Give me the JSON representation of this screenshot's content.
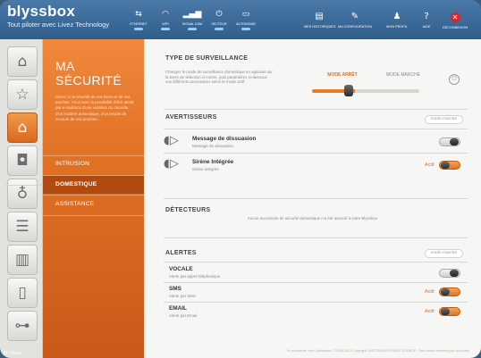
{
  "header": {
    "logo": "blyssbox",
    "tagline": "Tout piloter avec Livez Technology",
    "status": [
      {
        "label": "ETHERNET",
        "icon": "ethernet-icon"
      },
      {
        "label": "WIFI",
        "icon": "wifi-icon"
      },
      {
        "label": "SIGNAL GSM",
        "icon": "gsm-signal-icon"
      },
      {
        "label": "SECTEUR",
        "icon": "power-plug-icon"
      },
      {
        "label": "AUTONOMIE",
        "icon": "battery-icon"
      }
    ],
    "menu": [
      {
        "label": "MES HISTORIQUES",
        "icon": "book-icon"
      },
      {
        "label": "MA CONFIGURATION",
        "icon": "wrench-icon"
      },
      {
        "label": "MON PROFIL",
        "icon": "user-icon"
      },
      {
        "label": "AIDE",
        "icon": "help-icon"
      },
      {
        "label": "DÉCONNEXION",
        "icon": "logout-icon"
      }
    ]
  },
  "categories": [
    {
      "name": "home",
      "icon": "house-icon"
    },
    {
      "name": "ambiance",
      "icon": "star-icon"
    },
    {
      "name": "security",
      "icon": "padlock-icon"
    },
    {
      "name": "camera",
      "icon": "camera-icon"
    },
    {
      "name": "lighting",
      "icon": "bulb-icon"
    },
    {
      "name": "shutters",
      "icon": "shutter-icon"
    },
    {
      "name": "blinds",
      "icon": "blind-icon"
    },
    {
      "name": "devices",
      "icon": "appliance-icon"
    },
    {
      "name": "plugs",
      "icon": "plug-icon"
    }
  ],
  "lang_bar": "Fr  |  Nous",
  "panel": {
    "title_line1": "MA",
    "title_line2": "SÉCURITÉ",
    "description": "Gérez ici la sécurité de vos biens et de vos proches. Vous avez la possibilité d'être alerté par e-mail/sms d'une violation du domicile, d'un incident domestique, d'un besoin de secours de vos proches...",
    "items": [
      "INTRUSION",
      "DOMESTIQUE",
      "ASSISTANCE"
    ],
    "active_item": "DOMESTIQUE"
  },
  "surveillance": {
    "title": "TYPE DE SURVEILLANCE",
    "description": "Changez le mode de surveillance domestique en agissant sur la barre de sélection ci-contre, puis paramétrez ci-dessous vos différents accessoires selon le mode actif.",
    "mode_off": "MODE ARRÊT",
    "mode_on": "MODE MARCHE",
    "level": 0.4
  },
  "avertisseurs": {
    "title": "AVERTISSEURS",
    "mode_pill": "mode marche",
    "devices": [
      {
        "name": "Message de dissuasion",
        "sub": "Message de dissuasion",
        "status": "",
        "on": false
      },
      {
        "name": "Sirène Intégrée",
        "sub": "Sirène intégrée",
        "status": "Actif",
        "on": true
      }
    ]
  },
  "detecteurs": {
    "title": "DÉTECTEURS",
    "note": "Aucun accessoire de sécurité domestique n'a été associé à votre Blyssbox."
  },
  "alertes": {
    "title": "ALERTES",
    "mode_pill": "mode marche",
    "items": [
      {
        "name": "VOCALE",
        "sub": "Alerte par appel téléphonique",
        "status": "",
        "on": false
      },
      {
        "name": "SMS",
        "sub": "Alerte par SMS",
        "status": "Actif",
        "on": true
      },
      {
        "name": "EMAIL",
        "sub": "Alerte par Email",
        "status": "Actif",
        "on": true
      }
    ]
  },
  "footer": "En exclusivité chez Castorama - ©2006-2013 Copyright CASTORAMA FRANCE SOURCE - Tous droits réservés pour tous pays",
  "colors": {
    "accent": "#e07023",
    "header": "#2f5e8c"
  }
}
